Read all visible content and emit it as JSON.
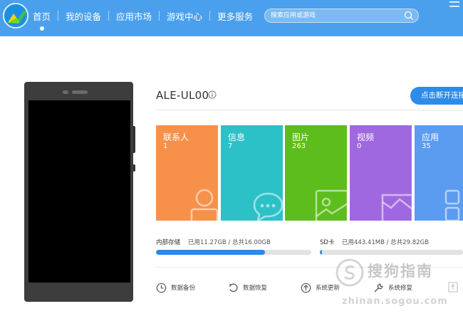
{
  "nav": {
    "items": [
      "首页",
      "我的设备",
      "应用市场",
      "游戏中心",
      "更多服务"
    ],
    "active_index": 0
  },
  "search": {
    "placeholder": "搜索应用或游戏"
  },
  "device": {
    "name": "ALE-UL00",
    "disconnect_label": "点击断开连接"
  },
  "tiles": [
    {
      "label": "联系人",
      "count": "1",
      "color": "#f7914a"
    },
    {
      "label": "信息",
      "count": "7",
      "color": "#2cc1c7"
    },
    {
      "label": "图片",
      "count": "263",
      "color": "#5dbd1c"
    },
    {
      "label": "视频",
      "count": "0",
      "color": "#a068e0"
    },
    {
      "label": "应用",
      "count": "35",
      "color": "#5b9cf0"
    }
  ],
  "storage": {
    "internal": {
      "label": "内部存储",
      "text": "已用11.27GB / 总共16.00GB",
      "used_fraction": 0.704
    },
    "sd": {
      "label": "SD卡",
      "text": "已用443.41MB / 总共29.82GB",
      "used_fraction": 0.015
    }
  },
  "actions": {
    "backup": "数据备份",
    "restore": "数据恢复",
    "update": "系统更新",
    "repair": "系统修复"
  },
  "watermark": {
    "text": "搜狗指南",
    "sub": "zhinan.sogou.com"
  },
  "colors": {
    "topbar": "#4aa0ec",
    "accent": "#2d8be9"
  }
}
